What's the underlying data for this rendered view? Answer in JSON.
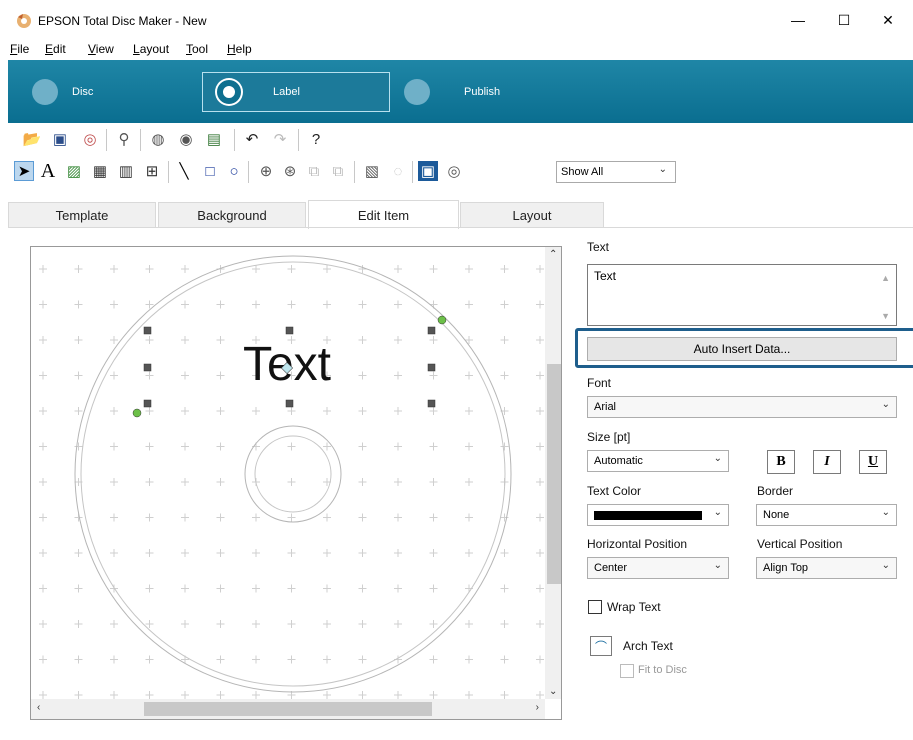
{
  "window": {
    "title": "EPSON Total Disc Maker - New",
    "minimize": "—",
    "maximize": "☐",
    "close": "✕"
  },
  "menu": [
    {
      "ul": "F",
      "rest": "ile"
    },
    {
      "ul": "E",
      "rest": "dit"
    },
    {
      "ul": "V",
      "rest": "iew"
    },
    {
      "pre": "",
      "ul": "L",
      "rest": "ayout"
    },
    {
      "ul": "T",
      "rest": "ool"
    },
    {
      "ul": "H",
      "rest": "elp"
    }
  ],
  "modes": {
    "disc": "Disc",
    "label": "Label",
    "publish": "Publish"
  },
  "toolbar": {
    "show_select": "Show All"
  },
  "tabs": [
    "Template",
    "Background",
    "Edit Item",
    "Layout"
  ],
  "canvas": {
    "text_item": "Text"
  },
  "panel": {
    "text_label": "Text",
    "text_value": "Text",
    "auto_insert": "Auto Insert Data...",
    "font_label": "Font",
    "font_value": "Arial",
    "size_label": "Size [pt]",
    "size_value": "Automatic",
    "bold": "B",
    "italic": "I",
    "underline": "U",
    "text_color_label": "Text Color",
    "border_label": "Border",
    "border_value": "None",
    "hpos_label": "Horizontal Position",
    "hpos_value": "Center",
    "vpos_label": "Vertical Position",
    "vpos_value": "Align Top",
    "wrap_text": "Wrap Text",
    "arch_text": "Arch Text",
    "fit_to_disc": "Fit to Disc"
  },
  "colors": {
    "accent": "#0a6e90",
    "highlight": "#1e5e8c",
    "text_color": "#000000"
  }
}
